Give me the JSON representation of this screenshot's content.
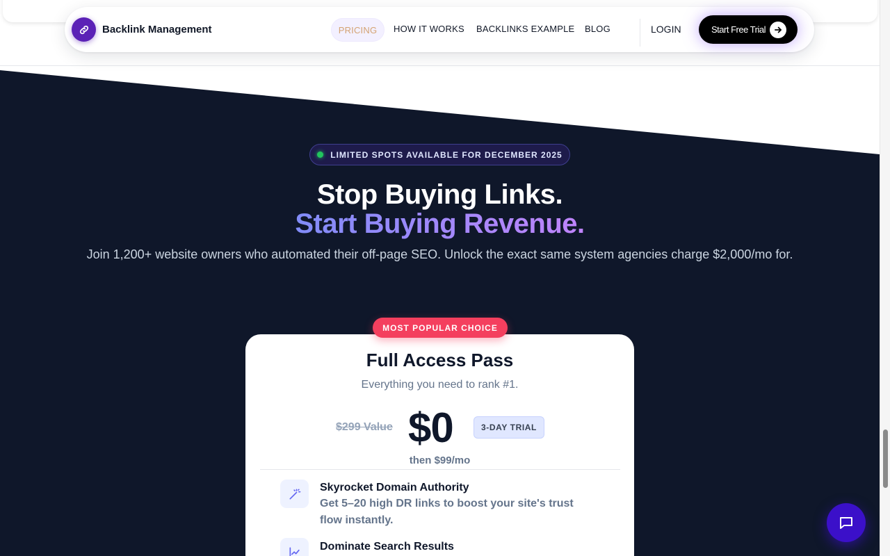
{
  "nav": {
    "brand": "Backlink Management",
    "links": [
      "PRICING",
      "HOW IT WORKS",
      "BACKLINKS EXAMPLE",
      "BLOG"
    ],
    "login": "LOGIN",
    "cta": "Start Free Trial"
  },
  "hero": {
    "badge": "LIMITED SPOTS AVAILABLE FOR DECEMBER 2025",
    "title_line1": "Stop Buying Links.",
    "title_line2": "Start Buying Revenue.",
    "subtitle": "Join 1,200+ website owners who automated their off-page SEO. Unlock the exact same system agencies charge $2,000/mo for."
  },
  "pricing": {
    "ribbon": "MOST POPULAR CHOICE",
    "plan_name": "Full Access Pass",
    "plan_tagline": "Everything you need to rank #1.",
    "old_price": "$299 Value",
    "price": "$0",
    "trial_tag": "3-DAY TRIAL",
    "then_price": "then $99/mo",
    "features": [
      {
        "icon": "magic-wand-icon",
        "title": "Skyrocket Domain Authority",
        "description": "Get 5–20 high DR links to boost your site's trust flow instantly."
      },
      {
        "icon": "trend-chart-icon",
        "title": "Dominate Search Results",
        "description": ""
      }
    ]
  },
  "colors": {
    "dark_bg": "#0f172a",
    "accent_purple": "#5b21b6",
    "ribbon_red": "#f43f5e",
    "status_green": "#22c55e"
  }
}
